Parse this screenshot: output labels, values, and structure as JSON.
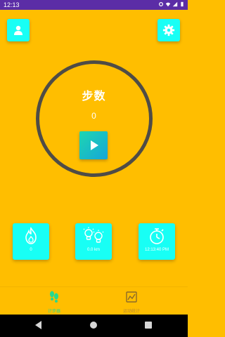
{
  "status_bar": {
    "time": "12:13",
    "background": "#5B2DA6",
    "icons": [
      "settings-gear-icon",
      "wifi-icon",
      "signal-icon",
      "battery-icon"
    ]
  },
  "header": {
    "profile_icon": "person-icon",
    "settings_icon": "gear-icon"
  },
  "step_counter": {
    "label": "步数",
    "value": "0",
    "play_icon": "play-icon"
  },
  "stats": [
    {
      "icon": "flame-icon",
      "value": "0"
    },
    {
      "icon": "bulb-icon",
      "value": "0.0 km"
    },
    {
      "icon": "stopwatch-icon",
      "value": "12:13:40 PM"
    }
  ],
  "bottom_nav": {
    "items": [
      {
        "icon": "footprints-icon",
        "label": "计步器",
        "active": true
      },
      {
        "icon": "chart-icon",
        "label": "运动统计",
        "active": false
      }
    ]
  },
  "colors": {
    "background": "#FFBE00",
    "button": "#18FFF5",
    "ring": "#4F4C46",
    "active_nav": "#26D98E"
  }
}
